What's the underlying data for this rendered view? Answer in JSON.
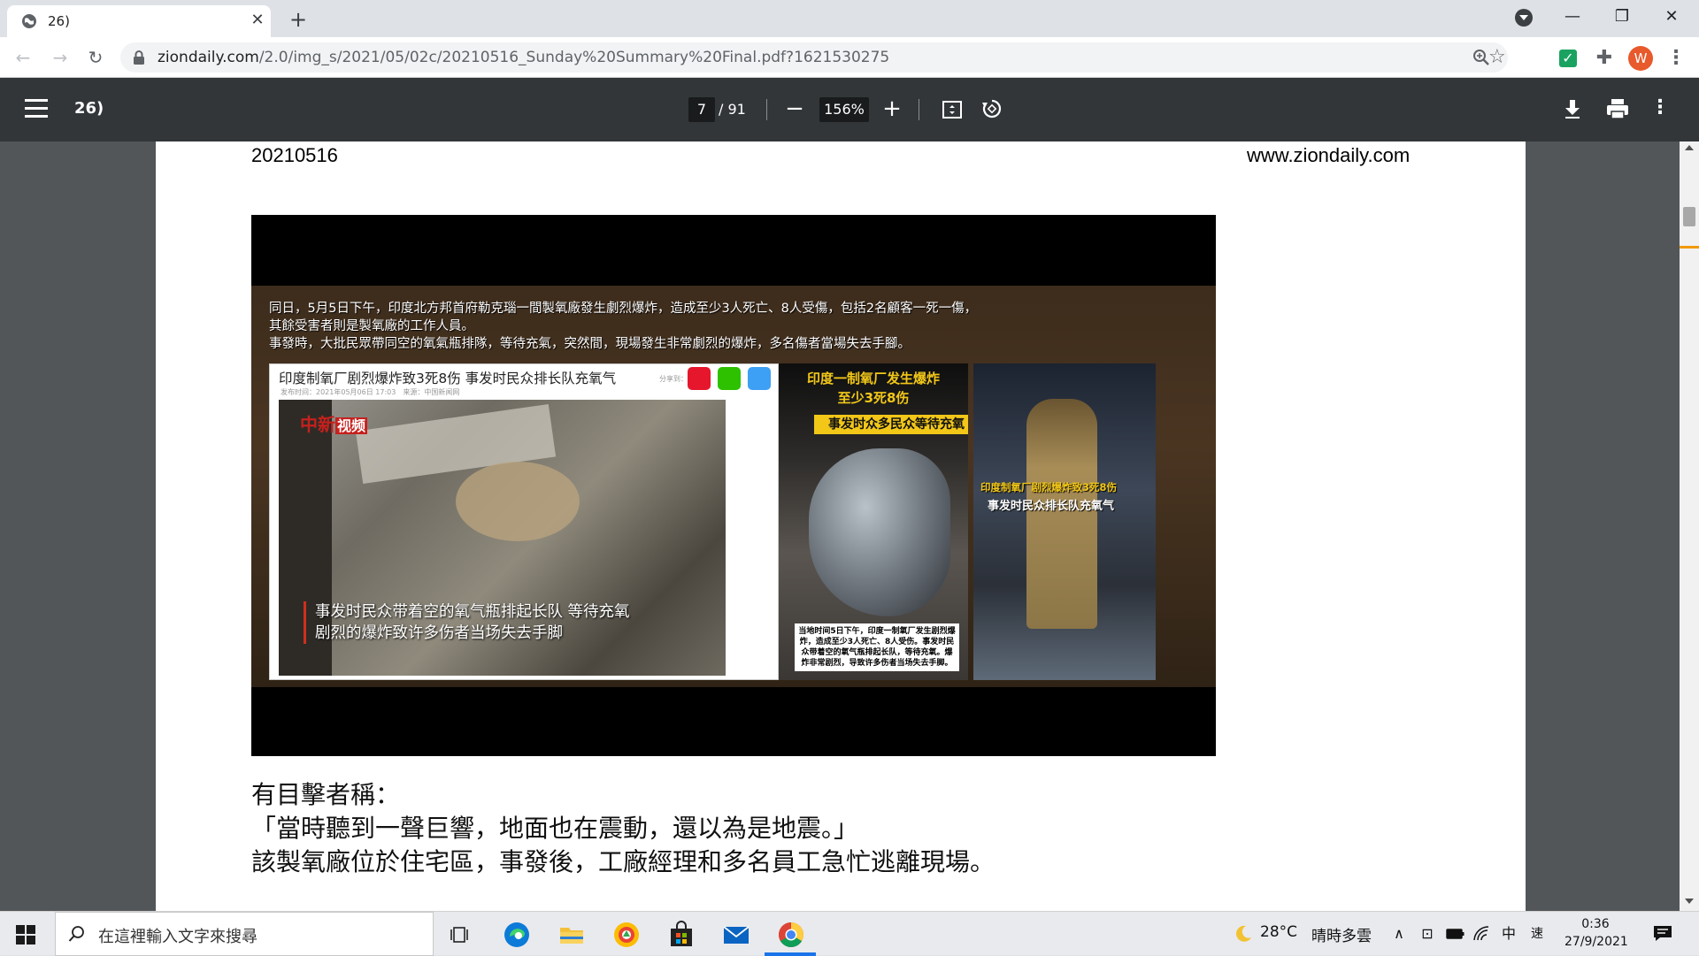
{
  "browser": {
    "tab_title": "26)",
    "tab_close": "✕",
    "new_tab": "+",
    "window_controls": {
      "minimize": "—",
      "maximize": "❐",
      "close": "✕"
    },
    "nav": {
      "back": "←",
      "forward": "→",
      "reload": "↻"
    },
    "url_host": "ziondaily.com",
    "url_path": "/2.0/img_s/2021/05/02c/20210516_Sunday%20Summary%20Final.pdf?1621530275",
    "avatar_letter": "W",
    "extension_check": "✓",
    "icons": [
      "lock-icon",
      "zoom-icon",
      "star-icon",
      "extension-icon",
      "puzzle-icon",
      "kebab-menu-icon"
    ]
  },
  "pdf_toolbar": {
    "title": "26)",
    "current_page": "7",
    "total_pages": "/ 91",
    "zoom": "156%",
    "zoom_out": "−",
    "zoom_in": "+",
    "more": "⋮"
  },
  "document": {
    "header_date": "20210516",
    "header_site": "www.ziondaily.com",
    "image_caption_lines": [
      "同日，5月5日下午，印度北方邦首府勒克瑙一間製氧廠發生劇烈爆炸，造成至少3人死亡、8人受傷，包括2名顧客一死一傷，",
      "其餘受害者則是製氧廠的工作人員。",
      "事發時，大批民眾帶同空的氧氣瓶排隊，等待充氣，突然間，現場發生非常劇烈的爆炸，多名傷者當場失去手腳。"
    ],
    "panel1": {
      "title": "印度制氧厂剧烈爆炸致3死8伤 事发时民众排长队充氧气",
      "subtitle": "发布时间：2021年05月06日 17:03　来源：中国新闻网",
      "share_label": "分享到：",
      "logo_main": "中新",
      "logo_box": "视频",
      "video_caption_1": "事发时民众带着空的氧气瓶排起长队 等待充氧",
      "video_caption_2": "剧烈的爆炸致许多伤者当场失去手脚"
    },
    "panel2": {
      "title_1": "印度一制氧厂发生爆炸",
      "title_2": "至少3死8伤",
      "banner": "事发时众多民众等待充氧",
      "box_text": "当地时间5日下午，印度一制氧厂发生剧烈爆炸，造成至少3人死亡、8人受伤。事发时民众带着空的氧气瓶排起长队，等待充氧。爆炸非常剧烈，导致许多伤者当场失去手脚。"
    },
    "panel3": {
      "caption_1": "印度制氧厂剧烈爆炸致3死8伤",
      "caption_2": "事发时民众排长队充氧气"
    },
    "body_lines": [
      "有目擊者稱：",
      "「當時聽到一聲巨響，地面也在震動，還以為是地震。」",
      "該製氧廠位於住宅區，事發後，工廠經理和多名員工急忙逃離現場。"
    ]
  },
  "taskbar": {
    "search_placeholder": "在這裡輸入文字來搜尋",
    "temperature": "28°C",
    "weather": "晴時多雲",
    "ime_lang": "中",
    "ime_mode": "速",
    "time": "0:36",
    "date": "27/9/2021",
    "tray_chevron": "∧",
    "apps": [
      "task-view-icon",
      "edge-icon",
      "file-explorer-icon",
      "browser-icon",
      "store-icon",
      "mail-icon",
      "chrome-icon"
    ]
  },
  "colors": {
    "pdf_toolbar_bg": "#323639",
    "viewer_bg": "#525659",
    "tab_strip_bg": "#dee1e6",
    "avatar_bg": "#e8592b",
    "accent_blue": "#1a73e8",
    "caption_yellow": "#f2c718"
  }
}
